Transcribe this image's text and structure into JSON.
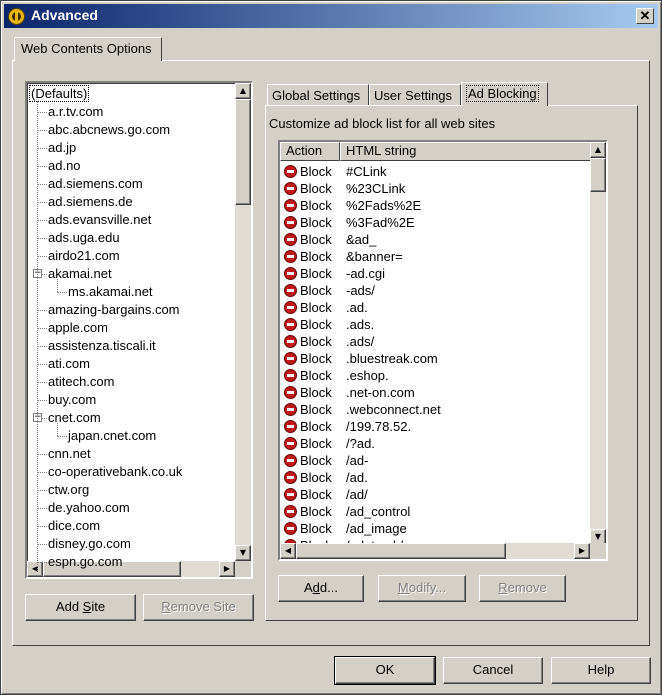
{
  "window": {
    "title": "Advanced",
    "close_glyph": "✕"
  },
  "outer_tab": {
    "label": "Web Contents Options"
  },
  "site_list": {
    "items": [
      {
        "label": "(Defaults)",
        "level": 0,
        "selected": true
      },
      {
        "label": "a.r.tv.com",
        "level": 1
      },
      {
        "label": "abc.abcnews.go.com",
        "level": 1
      },
      {
        "label": "ad.jp",
        "level": 1
      },
      {
        "label": "ad.no",
        "level": 1
      },
      {
        "label": "ad.siemens.com",
        "level": 1
      },
      {
        "label": "ad.siemens.de",
        "level": 1
      },
      {
        "label": "ads.evansville.net",
        "level": 1
      },
      {
        "label": "ads.uga.edu",
        "level": 1
      },
      {
        "label": "airdo21.com",
        "level": 1
      },
      {
        "label": "akamai.net",
        "level": 1,
        "expander": "−"
      },
      {
        "label": "ms.akamai.net",
        "level": 2
      },
      {
        "label": "amazing-bargains.com",
        "level": 1
      },
      {
        "label": "apple.com",
        "level": 1
      },
      {
        "label": "assistenza.tiscali.it",
        "level": 1
      },
      {
        "label": "ati.com",
        "level": 1
      },
      {
        "label": "atitech.com",
        "level": 1
      },
      {
        "label": "buy.com",
        "level": 1
      },
      {
        "label": "cnet.com",
        "level": 1,
        "expander": "−"
      },
      {
        "label": "japan.cnet.com",
        "level": 2
      },
      {
        "label": "cnn.net",
        "level": 1
      },
      {
        "label": "co-operativebank.co.uk",
        "level": 1
      },
      {
        "label": "ctw.org",
        "level": 1
      },
      {
        "label": "de.yahoo.com",
        "level": 1
      },
      {
        "label": "dice.com",
        "level": 1
      },
      {
        "label": "disney.go.com",
        "level": 1
      },
      {
        "label": "espn.go.com",
        "level": 1
      }
    ]
  },
  "site_buttons": {
    "add_pre": "Add ",
    "add_key": "S",
    "add_post": "ite",
    "remove_key": "R",
    "remove_post": "emove Site"
  },
  "inner_tabs": [
    {
      "label": "Global Settings"
    },
    {
      "label": "User Settings"
    },
    {
      "label": "Ad Blocking",
      "active": true
    }
  ],
  "ad_blocking": {
    "description": "Customize ad block list for all web sites",
    "columns": [
      "Action",
      "HTML string"
    ],
    "rows": [
      {
        "action": "Block",
        "string": "#CLink"
      },
      {
        "action": "Block",
        "string": "%23CLink"
      },
      {
        "action": "Block",
        "string": "%2Fads%2E"
      },
      {
        "action": "Block",
        "string": "%3Fad%2E"
      },
      {
        "action": "Block",
        "string": "&ad_"
      },
      {
        "action": "Block",
        "string": "&banner="
      },
      {
        "action": "Block",
        "string": "-ad.cgi"
      },
      {
        "action": "Block",
        "string": "-ads/"
      },
      {
        "action": "Block",
        "string": ".ad."
      },
      {
        "action": "Block",
        "string": ".ads."
      },
      {
        "action": "Block",
        "string": ".ads/"
      },
      {
        "action": "Block",
        "string": ".bluestreak.com"
      },
      {
        "action": "Block",
        "string": ".eshop."
      },
      {
        "action": "Block",
        "string": ".net-on.com"
      },
      {
        "action": "Block",
        "string": ".webconnect.net"
      },
      {
        "action": "Block",
        "string": "/199.78.52."
      },
      {
        "action": "Block",
        "string": "/?ad."
      },
      {
        "action": "Block",
        "string": "/ad-"
      },
      {
        "action": "Block",
        "string": "/ad."
      },
      {
        "action": "Block",
        "string": "/ad/"
      },
      {
        "action": "Block",
        "string": "/ad_control"
      },
      {
        "action": "Block",
        "string": "/ad_image"
      },
      {
        "action": "Block",
        "string": "/ad_track/"
      }
    ],
    "add_pre": "A",
    "add_key": "d",
    "add_post": "d...",
    "modify_key": "M",
    "modify_post": "odify...",
    "remove_key": "R",
    "remove_post": "emove"
  },
  "footer": {
    "ok": "OK",
    "cancel": "Cancel",
    "help": "Help"
  },
  "icons": {
    "block": "stop-icon",
    "app": "app-icon"
  },
  "colors": {
    "title_start": "#0a246a",
    "title_end": "#a6caf0",
    "block_icon": "#c01818"
  }
}
